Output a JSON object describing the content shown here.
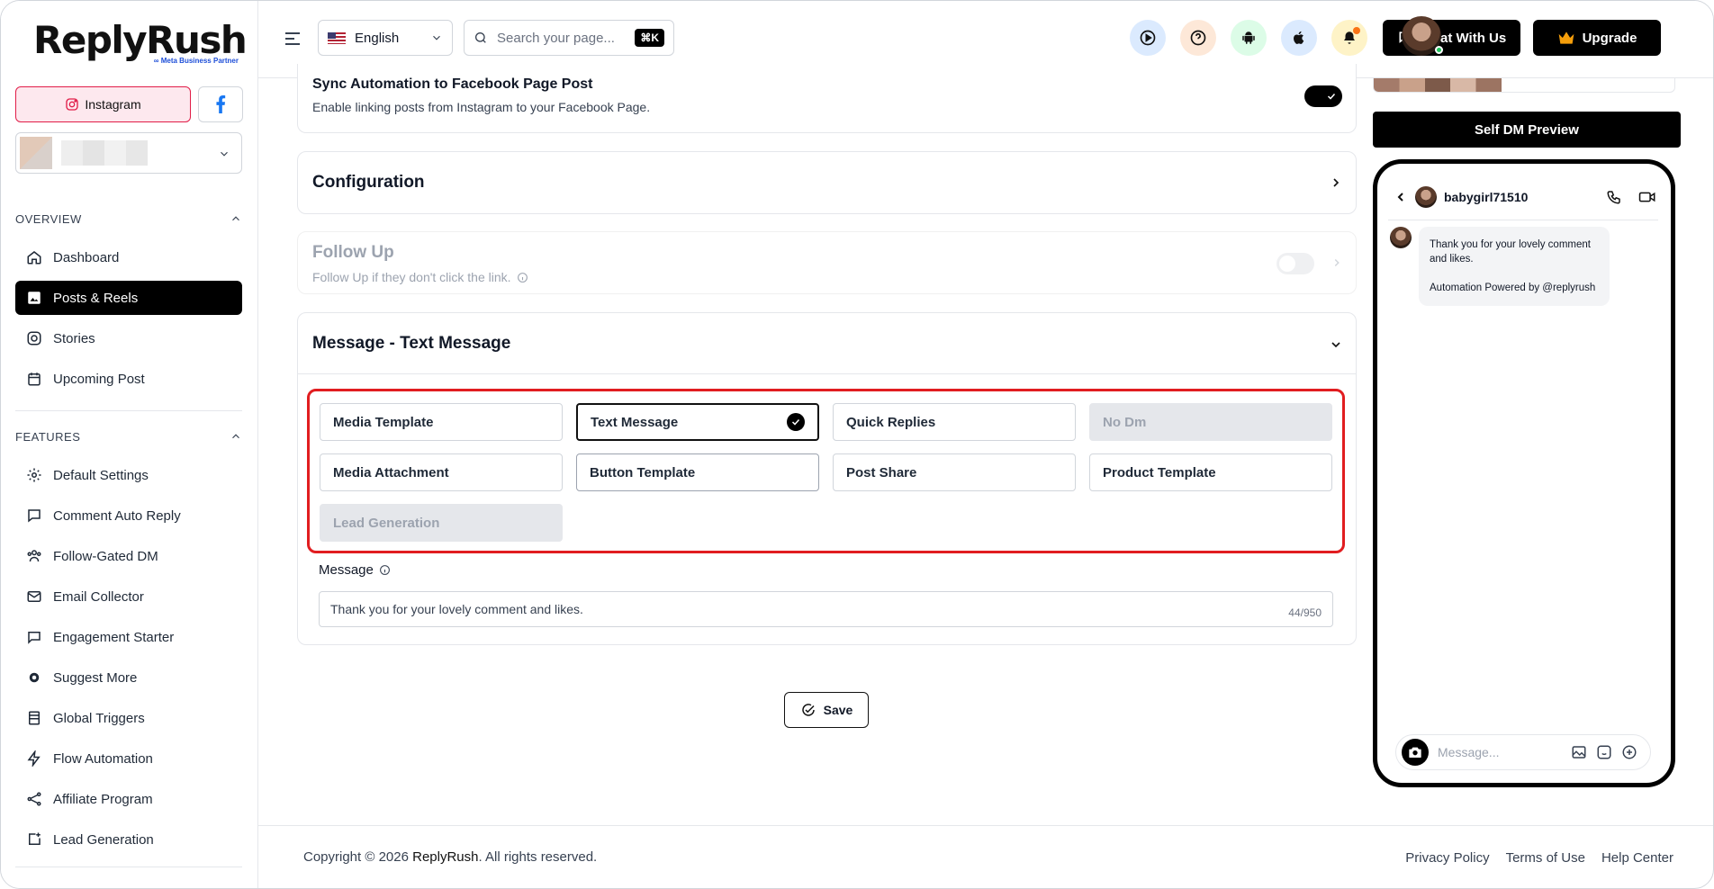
{
  "brand": {
    "name": "ReplyRush",
    "tagline": "Meta Business Partner"
  },
  "sidebar": {
    "platforms": {
      "instagram_label": "Instagram"
    },
    "overview_label": "OVERVIEW",
    "overview_items": [
      {
        "label": "Dashboard",
        "icon": "home-icon"
      },
      {
        "label": "Posts & Reels",
        "icon": "image-icon",
        "active": true
      },
      {
        "label": "Stories",
        "icon": "instagram-icon"
      },
      {
        "label": "Upcoming Post",
        "icon": "calendar-icon"
      }
    ],
    "features_label": "FEATURES",
    "feature_items": [
      {
        "label": "Default Settings",
        "icon": "gear-icon"
      },
      {
        "label": "Comment Auto Reply",
        "icon": "comment-icon"
      },
      {
        "label": "Follow-Gated DM",
        "icon": "users-icon"
      },
      {
        "label": "Email Collector",
        "icon": "mail-icon"
      },
      {
        "label": "Engagement Starter",
        "icon": "chat-bubble-icon"
      },
      {
        "label": "Suggest More",
        "icon": "cog-icon"
      },
      {
        "label": "Global Triggers",
        "icon": "list-icon"
      },
      {
        "label": "Flow Automation",
        "icon": "bolt-icon"
      },
      {
        "label": "Affiliate Program",
        "icon": "share-icon"
      },
      {
        "label": "Lead Generation",
        "icon": "plus-square-icon"
      }
    ]
  },
  "topbar": {
    "language": "English",
    "search_placeholder": "Search your page...",
    "search_shortcut": "⌘K",
    "chat_label": "Chat With Us",
    "upgrade_label": "Upgrade",
    "icons": [
      "play-icon",
      "help-icon",
      "android-icon",
      "apple-icon",
      "bell-icon"
    ],
    "accent_colors": {
      "play": "#dbeafe",
      "help": "#fde8d8",
      "android": "#dcfce7",
      "apple": "#dbeafe",
      "bell": "#fef3c7"
    }
  },
  "main": {
    "sync": {
      "title": "Sync Automation to Facebook Page Post",
      "description": "Enable linking posts from Instagram to your Facebook Page.",
      "enabled": true
    },
    "configuration": {
      "title": "Configuration"
    },
    "follow_up": {
      "title": "Follow Up",
      "description": "Follow Up if they don't click the link.",
      "enabled": false
    },
    "message_section": {
      "title": "Message - Text Message",
      "options": [
        {
          "label": "Media Template",
          "state": "normal"
        },
        {
          "label": "Text Message",
          "state": "selected"
        },
        {
          "label": "Quick Replies",
          "state": "normal"
        },
        {
          "label": "No Dm",
          "state": "disabled"
        },
        {
          "label": "Media Attachment",
          "state": "normal"
        },
        {
          "label": "Button Template",
          "state": "normal"
        },
        {
          "label": "Post Share",
          "state": "normal"
        },
        {
          "label": "Product Template",
          "state": "normal"
        },
        {
          "label": "Lead Generation",
          "state": "disabled"
        }
      ],
      "message_label": "Message",
      "message_value": "Thank you for your lovely comment and likes.",
      "char_count": "44/950"
    },
    "save_label": "Save"
  },
  "footer": {
    "copyright_prefix": "Copyright © 2026",
    "copyright_brand": "ReplyRush",
    "copyright_suffix": ". All rights reserved.",
    "links": [
      "Privacy Policy",
      "Terms of Use",
      "Help Center"
    ]
  },
  "preview": {
    "button_label": "Self DM Preview",
    "username": "babygirl71510",
    "message_line1": "Thank you for your lovely comment and likes.",
    "message_line2": "Automation Powered by @replyrush",
    "input_placeholder": "Message..."
  },
  "colors": {
    "highlight": "#e11d20",
    "instagram_bg": "#fde8ee",
    "facebook": "#1877f2"
  }
}
